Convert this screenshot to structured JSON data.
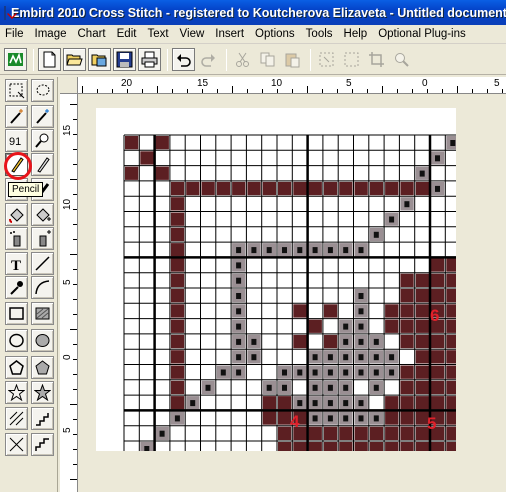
{
  "window": {
    "title": "Embird 2010 Cross Stitch - registered to Koutcherova Elizaveta - Untitled document"
  },
  "menu": [
    "File",
    "Image",
    "Chart",
    "Edit",
    "Text",
    "View",
    "Insert",
    "Options",
    "Tools",
    "Help",
    "Optional Plug-ins"
  ],
  "toolbar": {
    "icons": [
      "embird-logo-icon",
      "new-document-icon",
      "open-folder-icon",
      "open-image-icon",
      "save-icon",
      "print-icon",
      "undo-icon",
      "redo-icon",
      "cut-icon",
      "copy-icon",
      "paste-icon",
      "select-icon",
      "select-all-icon",
      "crop-icon",
      "zoom-icon"
    ]
  },
  "toolbox": {
    "tooltip": "Pencil",
    "tools": [
      "rect-select-icon",
      "lasso-select-icon",
      "magic-wand-icon",
      "magic-wand-plus-icon",
      "color-picker-icon",
      "zoom-icon",
      "pencil-icon",
      "eraser-icon",
      "backstitch-icon",
      "brush-icon",
      "fill-icon",
      "fill-plus-icon",
      "spray-icon",
      "spray-plus-icon",
      "text-icon",
      "line-icon",
      "eyedropper-icon",
      "curve-icon",
      "rectangle-icon",
      "filled-rectangle-icon",
      "ellipse-icon",
      "filled-ellipse-icon",
      "polygon-icon",
      "filled-polygon-icon",
      "star-icon",
      "filled-star-icon",
      "hatch-icon",
      "steps-icon",
      "crosshatch-icon",
      "stairs-icon"
    ]
  },
  "rulers": {
    "top": [
      "20",
      "15",
      "10",
      "5",
      "0",
      "5"
    ],
    "left": [
      "15",
      "10",
      "5",
      "0",
      "5"
    ]
  },
  "annotations": {
    "n4": "4",
    "n5": "5",
    "n6": "6"
  },
  "colors": {
    "dark_fill": "#5c1f22",
    "symbol_fill": "#9a8f93",
    "grid_line": "#000000",
    "accent_red": "#e0202a"
  }
}
